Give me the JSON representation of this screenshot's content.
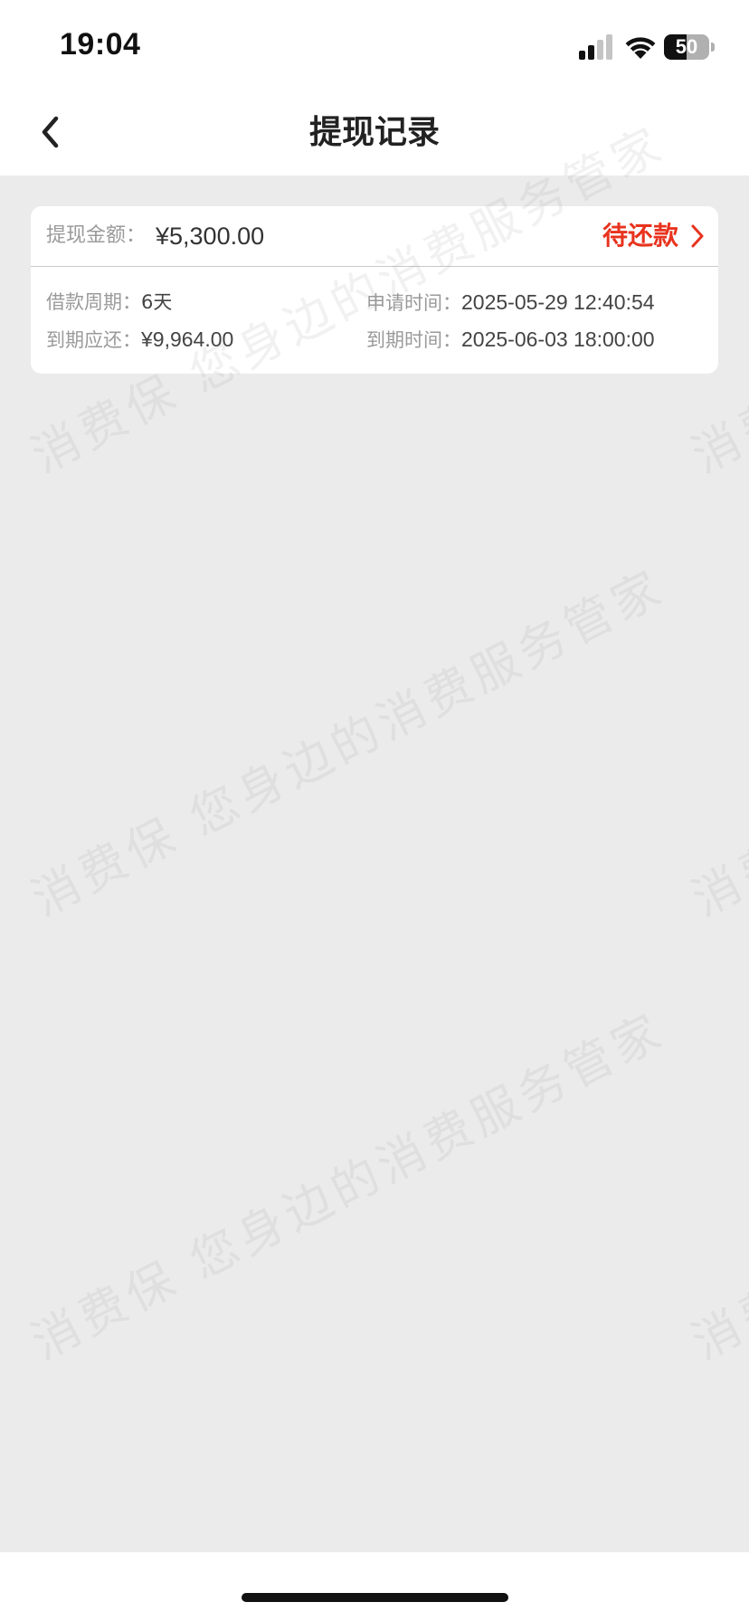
{
  "status_bar": {
    "time": "19:04",
    "battery": "50",
    "battery_level": 0.5
  },
  "nav": {
    "title": "提现记录"
  },
  "record": {
    "amount_label": "提现金额：",
    "amount_value": "¥5,300.00",
    "status": "待还款",
    "period_label": "借款周期：",
    "period_value": "6天",
    "apply_time_label": "申请时间：",
    "apply_time_value": "2025-05-29 12:40:54",
    "due_amount_label": "到期应还：",
    "due_amount_value": "¥9,964.00",
    "due_time_label": "到期时间：",
    "due_time_value": "2025-06-03 18:00:00"
  },
  "watermark": {
    "text": "消费保 您身边的消费服务管家"
  },
  "colors": {
    "status_red": "#e8331e",
    "background": "#ebebeb"
  }
}
